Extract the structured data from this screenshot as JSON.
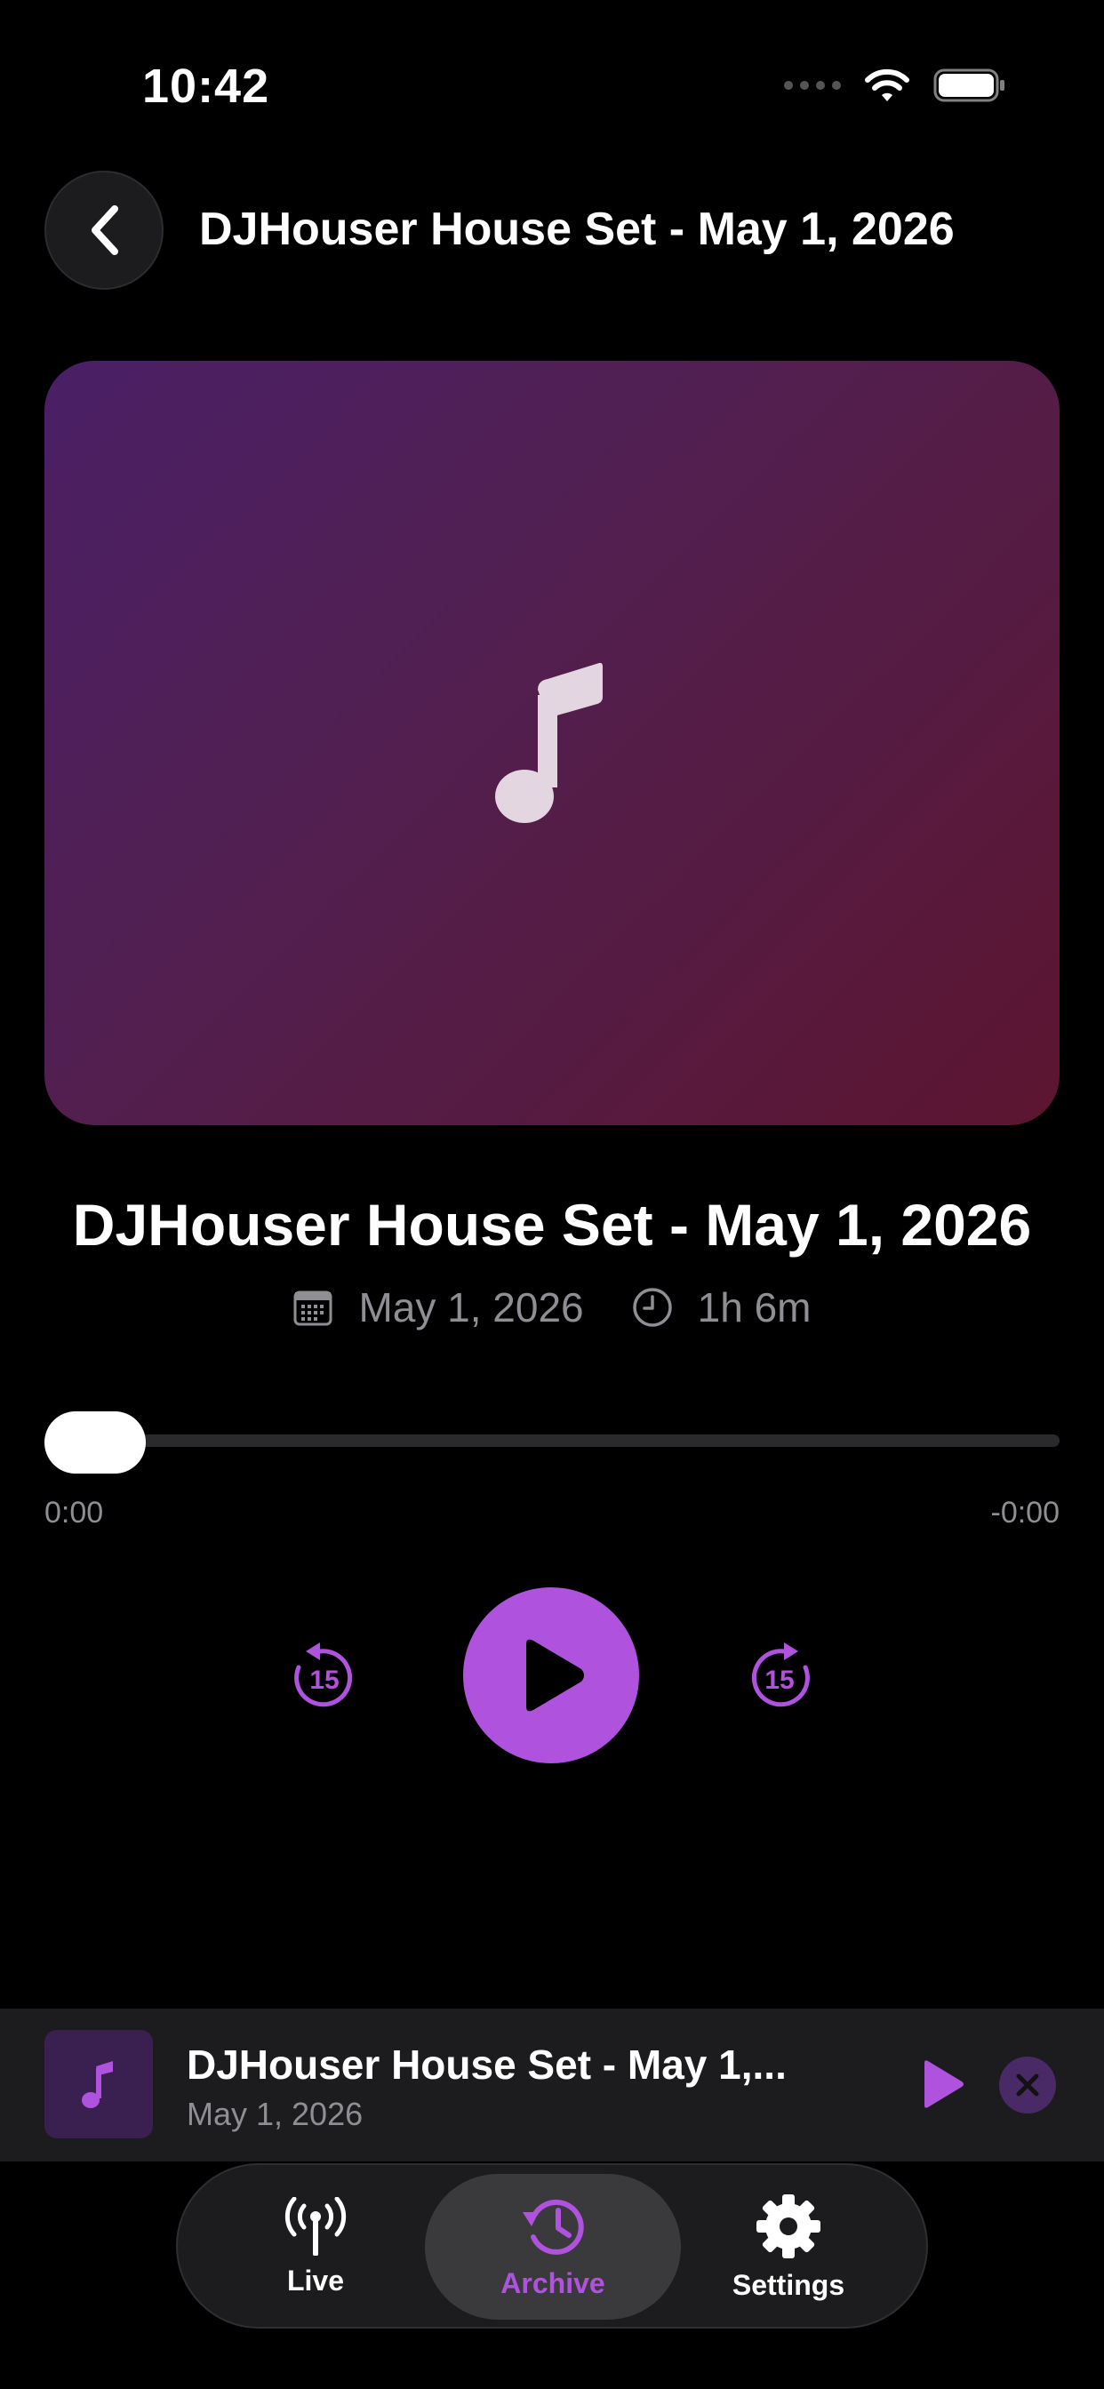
{
  "status_bar": {
    "time": "10:42"
  },
  "header": {
    "title": "DJHouser House Set - May 1, 2026"
  },
  "artwork": {
    "icon": "music-note-icon"
  },
  "track": {
    "title": "DJHouser House Set - May 1, 2026",
    "date": "May 1, 2026",
    "duration": "1h 6m"
  },
  "progress": {
    "elapsed": "0:00",
    "remaining": "-0:00",
    "fraction": 0.0
  },
  "controls": {
    "skip_back_seconds": "15",
    "skip_forward_seconds": "15"
  },
  "mini_player": {
    "title": "DJHouser House Set - May 1,...",
    "subtitle": "May 1, 2026"
  },
  "tabs": [
    {
      "label": "Live",
      "icon": "broadcast-icon"
    },
    {
      "label": "Archive",
      "icon": "history-icon",
      "selected": true
    },
    {
      "label": "Settings",
      "icon": "gear-icon"
    }
  ],
  "colors": {
    "accent": "#af52de",
    "background": "#000000",
    "surface": "#1c1c1e",
    "secondary_text": "#8e8e93"
  }
}
